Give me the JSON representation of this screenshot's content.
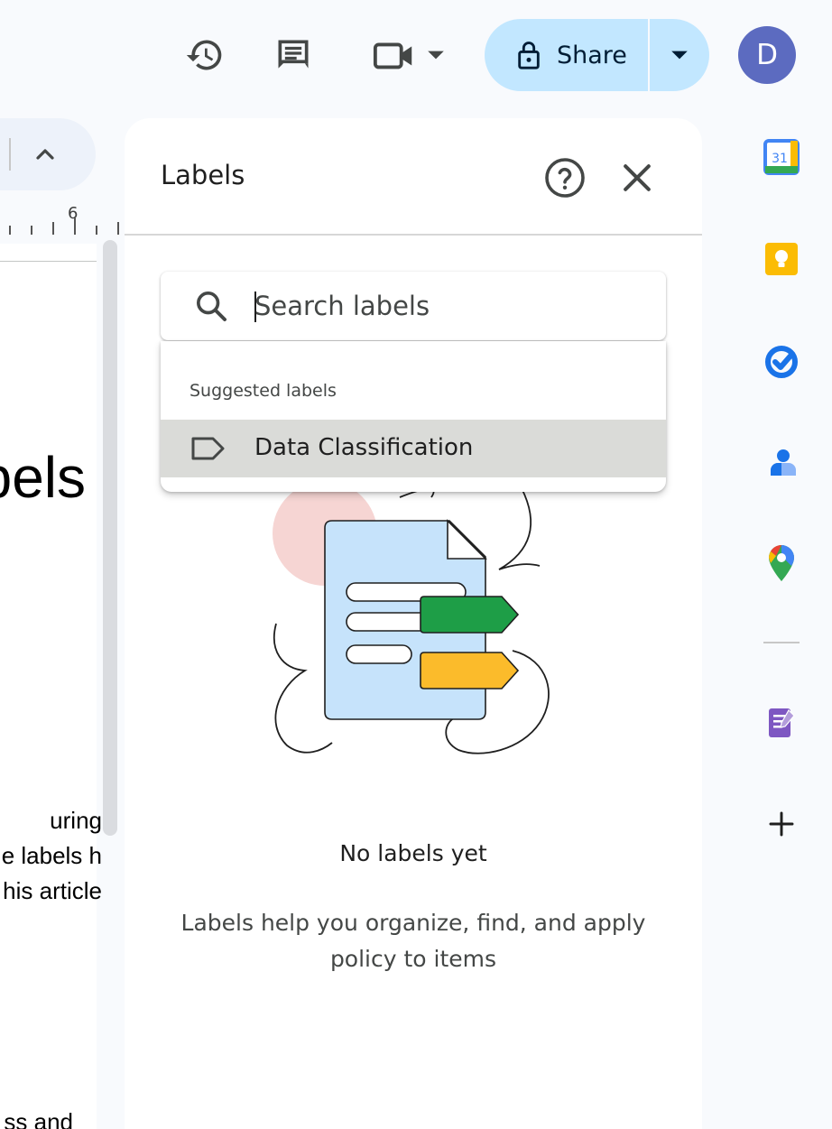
{
  "toolbar": {
    "history_icon": "history-icon",
    "comment_icon": "comment-icon",
    "meet_icon": "video-camera-icon",
    "share_label": "Share",
    "avatar_initial": "D",
    "colors": {
      "share_bg": "#c2e7ff",
      "avatar_bg": "#5c6bc0"
    }
  },
  "document": {
    "ruler_number": "6",
    "heading_fragment": "bels",
    "body_lines": [
      "uring",
      "e labels h",
      "his article"
    ],
    "footer_fragment": "ss and"
  },
  "labels_panel": {
    "title": "Labels",
    "search": {
      "placeholder": "Search labels",
      "value": ""
    },
    "suggested_header": "Suggested labels",
    "suggestions": [
      {
        "label": "Data Classification",
        "icon": "label-tag-icon"
      }
    ],
    "empty_state": {
      "title": "No labels yet",
      "description": "Labels help you organize, find, and apply policy to items"
    }
  },
  "side_rail": {
    "apps": [
      "calendar-icon",
      "keep-icon",
      "tasks-icon",
      "contacts-icon",
      "maps-icon",
      "forms-addon-icon",
      "add-icon"
    ],
    "calendar_day": "31"
  }
}
